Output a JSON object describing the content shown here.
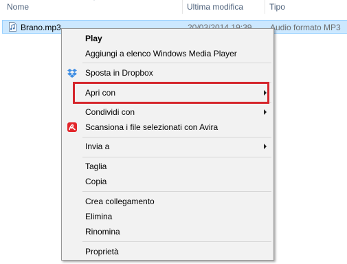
{
  "columns": {
    "name": "Nome",
    "modified": "Ultima modifica",
    "type": "Tipo"
  },
  "file": {
    "name": "Brano.mp3",
    "modified": "20/03/2014 19:39",
    "type": "Audio formato MP3",
    "icon": "audio-file-icon"
  },
  "menu": {
    "items": [
      {
        "label": "Play",
        "bold": true
      },
      {
        "label": "Aggiungi a elenco Windows Media Player"
      },
      {
        "label": "Sposta in Dropbox",
        "icon": "dropbox-icon"
      },
      {
        "label": "Apri con",
        "submenu": true,
        "highlighted": true
      },
      {
        "label": "Condividi con",
        "submenu": true
      },
      {
        "label": "Scansiona i file selezionati con Avira",
        "icon": "avira-icon"
      },
      {
        "label": "Invia a",
        "submenu": true
      },
      {
        "label": "Taglia"
      },
      {
        "label": "Copia"
      },
      {
        "label": "Crea collegamento"
      },
      {
        "label": "Elimina"
      },
      {
        "label": "Rinomina"
      },
      {
        "label": "Proprietà"
      }
    ]
  },
  "colors": {
    "highlight": "#d5262c",
    "selection": "#cce8ff",
    "dropbox": "#3d8de3",
    "avira": "#e3262b"
  }
}
